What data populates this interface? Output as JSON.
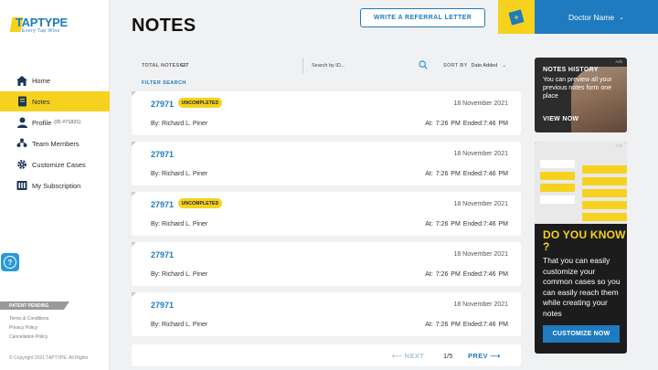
{
  "brand": {
    "name": "TAPTYPE",
    "tagline": "Every Tap Wins"
  },
  "sidebar": {
    "items": [
      {
        "label": "Home",
        "icon": "home-icon"
      },
      {
        "label": "Notes",
        "icon": "notebook-icon",
        "active": true
      },
      {
        "label": "Profile",
        "sub": "(ID #71821)",
        "icon": "user-icon"
      },
      {
        "label": "Team Members",
        "icon": "team-icon"
      },
      {
        "label": "Customize Cases",
        "icon": "gear-icon"
      },
      {
        "label": "My Subscription",
        "icon": "subscription-icon"
      }
    ],
    "patent": "PATENT PENDING",
    "links": [
      "Terms & Conditions",
      "Privacy Policy",
      "Cancellation Policy"
    ],
    "copyright": "© Copyright 2021 TAPTYPE. All Rights"
  },
  "header": {
    "title": "NOTES",
    "referral_label": "WRITE A REFERRAL LETTER",
    "doctor_name": "Doctor Name"
  },
  "toolbar": {
    "total_label": "TOTAL NOTES",
    "total_value": "627",
    "search_placeholder": "Search by ID...",
    "sort_label": "SORT BY",
    "sort_value": "Date Added",
    "filter_label": "FILTER SEARCH"
  },
  "notes": [
    {
      "id": "27971",
      "status": "UNCOMPLETED",
      "date": "18 November 2021",
      "by": "By: Richard L. Piner",
      "times": "At: 7:26 PM   Ended:7:46 PM"
    },
    {
      "id": "27971",
      "status": "",
      "date": "18 November 2021",
      "by": "By: Richard L. Piner",
      "times": "At: 7:26 PM   Ended:7:46 PM"
    },
    {
      "id": "27971",
      "status": "UNCOMPLETED",
      "date": "18 November 2021",
      "by": "By: Richard L. Piner",
      "times": "At: 7:26 PM   Ended:7:46 PM"
    },
    {
      "id": "27971",
      "status": "",
      "date": "18 November 2021",
      "by": "By: Richard L. Piner",
      "times": "At: 7:26 PM   Ended:7:46 PM"
    },
    {
      "id": "27971",
      "status": "",
      "date": "18 November 2021",
      "by": "By: Richard L. Piner",
      "times": "At: 7:26 PM   Ended:7:46 PM"
    }
  ],
  "pagination": {
    "next_label": "NEXT",
    "page": "1/5",
    "prev_label": "PREV"
  },
  "ads": {
    "tag": "Ads",
    "history": {
      "title": "NOTES HISTORY",
      "body": "You can preview all your previous notes form one place",
      "cta": "VIEW NOW"
    },
    "know": {
      "title": "DO YOU KNOW ?",
      "body": "That you can easily customize your common cases so you can easily reach them while creating your notes",
      "cta": "CUSTOMIZE NOW"
    }
  },
  "colors": {
    "accent": "#1f7bc0",
    "highlight": "#f6d21f"
  }
}
